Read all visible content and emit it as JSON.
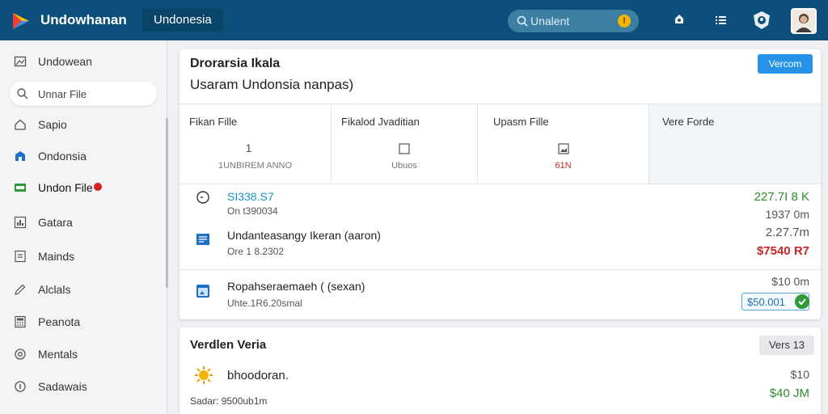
{
  "app": {
    "title": "Undowhanan",
    "region": "Undonesia"
  },
  "topbar": {
    "search_value": "Unalent",
    "search_badge": "!",
    "icons": [
      "notification-icon",
      "list-icon",
      "shield-icon",
      "avatar"
    ]
  },
  "sidebar": {
    "items": [
      {
        "label": "Undowean",
        "icon": "image-icon"
      },
      {
        "label": "Unnar File",
        "icon": "search-icon"
      },
      {
        "label": "Sapio",
        "icon": "home-icon"
      },
      {
        "label": "Ondonsia",
        "icon": "building-icon"
      },
      {
        "label": "Undon File",
        "icon": "card-icon"
      },
      {
        "label": "Gatara",
        "icon": "chart-icon"
      },
      {
        "label": "Mainds",
        "icon": "document-icon"
      },
      {
        "label": "Alclals",
        "icon": "edit-icon"
      },
      {
        "label": "Peanota",
        "icon": "calculator-icon"
      },
      {
        "label": "Mentals",
        "icon": "settings-icon"
      },
      {
        "label": "Sadawais",
        "icon": "info-icon"
      }
    ]
  },
  "card1": {
    "title": "Drorarsia Ikala",
    "subtitle": "Usaram Undonsia nanpas)",
    "button": "Vercom",
    "stats": [
      {
        "label": "Fikan Fille",
        "value": "1",
        "sub": "1UNBIREM ANNO"
      },
      {
        "label": "Fikalod Jvaditian",
        "value": "",
        "sub": "Ubuos"
      },
      {
        "label": "Upasm Fille",
        "value": "",
        "sub": "61N"
      },
      {
        "label": "Vere Forde",
        "value": "",
        "sub": ""
      }
    ],
    "rows": [
      {
        "title": "SI338.S7",
        "meta": "On t390034",
        "amount": "227.7I 8 K",
        "amount2": "1937 0m"
      },
      {
        "title": "Undanteasangy Ikeran (aaron)",
        "meta": "Ore 1 8.2302",
        "amount": "2.27.7m",
        "amount2": "$7540 R7"
      },
      {
        "title": "Ropahseraemaeh ( (sexan)",
        "meta": "Uhte.1R6.20smal",
        "amount": "$10 0m",
        "chip": "$50.001"
      }
    ]
  },
  "card2": {
    "title": "Verdlen Veria",
    "button": "Vers 13",
    "name": "bhoodoran.",
    "meta": "Sadar: 9500ub1m",
    "amount1": "$10",
    "amount2": "$40 JM"
  },
  "colors": {
    "topbar": "#0b4f7a",
    "accent": "#2693e6",
    "positive": "#2e8b2e",
    "negative": "#c62828",
    "link": "#1a8fc9"
  }
}
